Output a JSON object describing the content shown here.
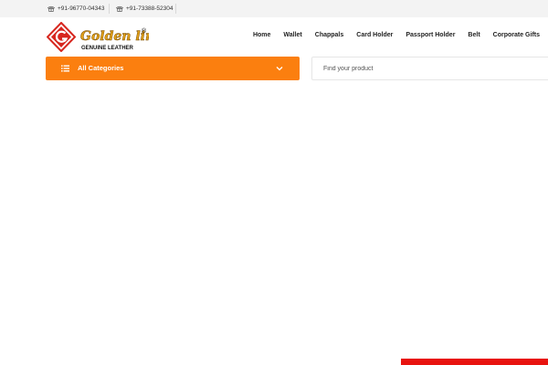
{
  "topbar": {
    "phones": [
      {
        "number": "+91-96770-04343",
        "icon": "phone-icon"
      },
      {
        "number": "+91-73388-52304",
        "icon": "phone-icon"
      }
    ]
  },
  "logo": {
    "brand": "Golden line",
    "registered": "®",
    "tagline": "GENUINE LEATHER"
  },
  "nav": {
    "items": [
      "Home",
      "Wallet",
      "Chappals",
      "Card Holder",
      "Passport Holder",
      "Belt",
      "Corporate Gifts"
    ]
  },
  "categories": {
    "label": "All Categories",
    "icon": "list-icon",
    "chevron": "chevron-down-icon"
  },
  "search": {
    "value": "",
    "placeholder": "Find your product"
  },
  "colors": {
    "accent": "#fb7f0f",
    "topbar_bg": "#f3f3f3",
    "footer_strip": "#e8130f",
    "logo_red": "#d7261e",
    "logo_gold": "#e2a21a"
  }
}
